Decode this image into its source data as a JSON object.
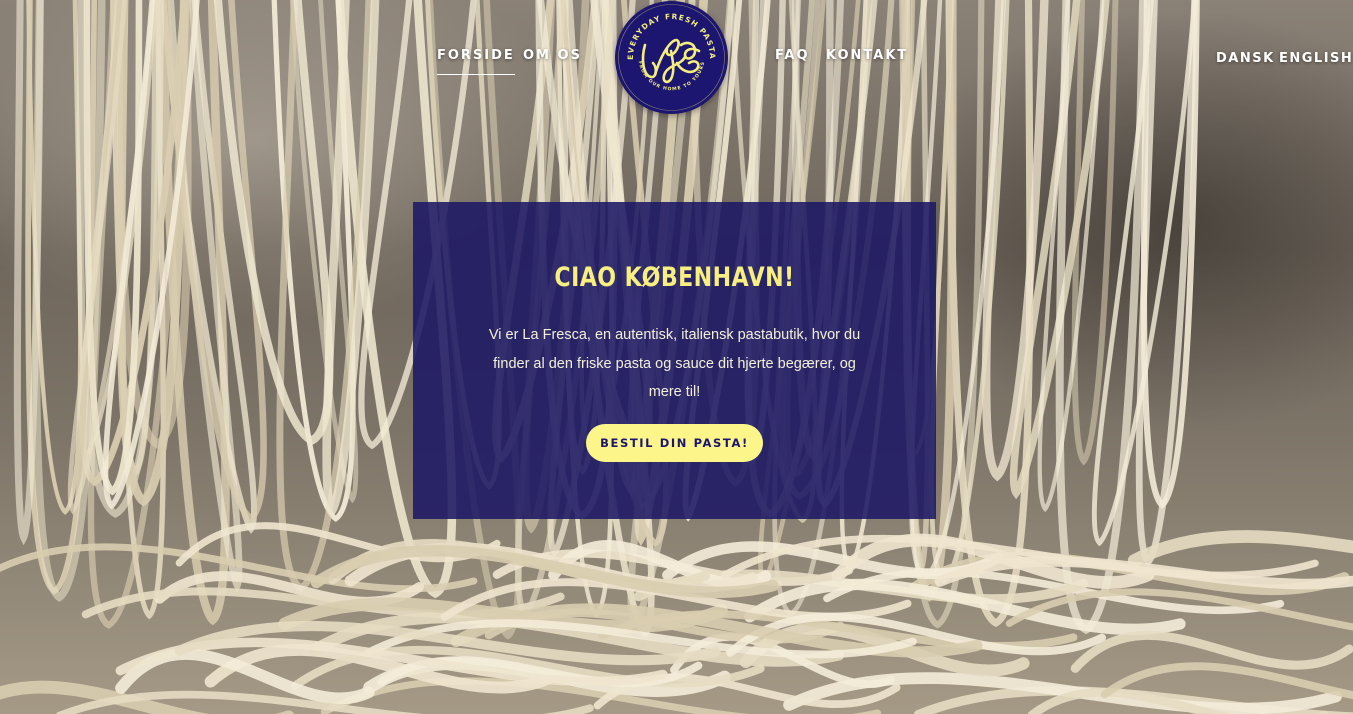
{
  "nav": {
    "left": [
      {
        "label": "FORSIDE",
        "active": true
      },
      {
        "label": "OM OS",
        "active": false
      }
    ],
    "right": [
      {
        "label": "FAQ"
      },
      {
        "label": "KONTAKT"
      }
    ]
  },
  "languages": {
    "dansk": "DANSK",
    "english": "ENGLISH"
  },
  "logo": {
    "wordmark": "laFresca",
    "tagline_top": "EVERYDAY FRESH PASTA",
    "tagline_bottom": "FROM OUR HOME TO YOURS"
  },
  "hero": {
    "title": "CIAO KØBENHAVN!",
    "body": "Vi er La Fresca, en autentisk, italiensk pastabutik, hvor du finder al den friske pasta og sauce dit hjerte begærer, og mere til!",
    "cta": "BESTIL DIN PASTA!"
  },
  "colors": {
    "brand_navy": "#1c1670",
    "brand_yellow": "#fbf58a",
    "nav_text": "#ffffff"
  },
  "background": {
    "image_subject": "fresh pasta strands hanging"
  }
}
